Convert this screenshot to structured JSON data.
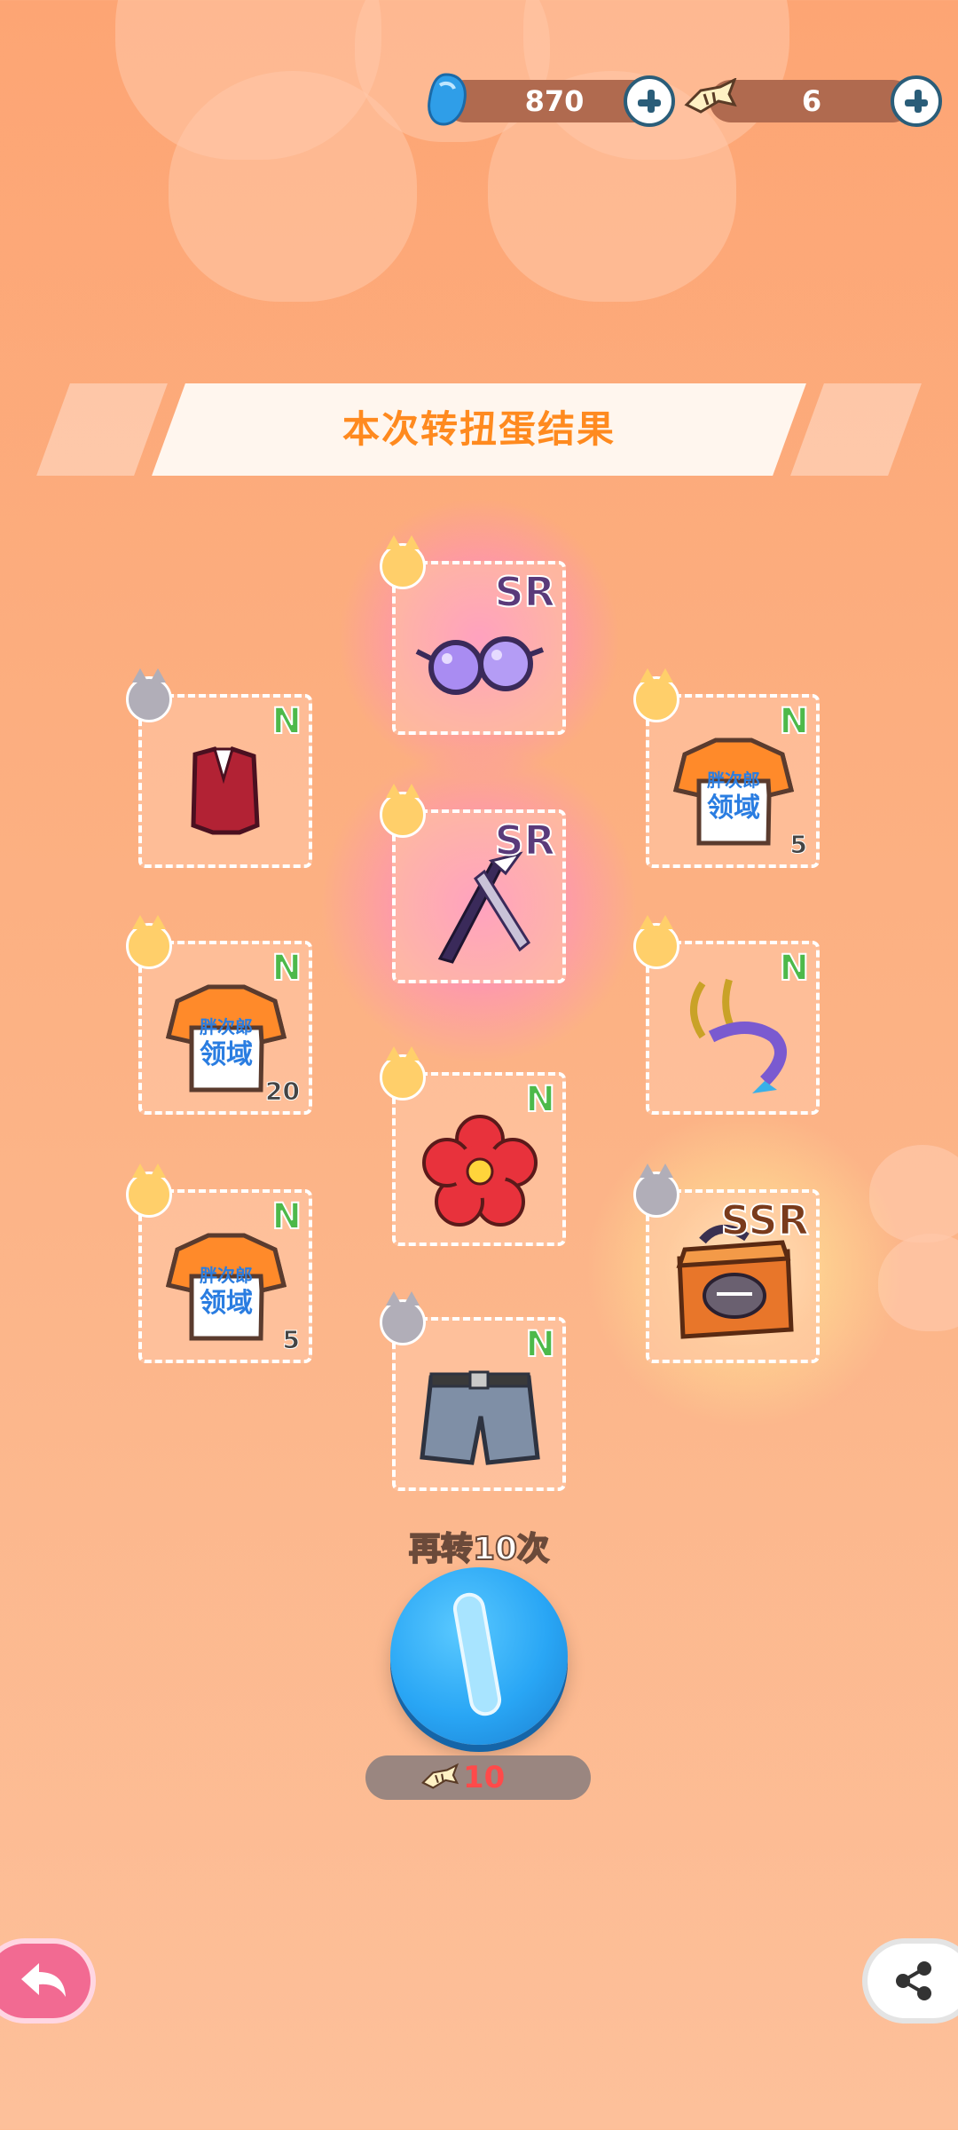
{
  "colors": {
    "background": "#fda574",
    "title_text": "#ff8a1f",
    "rarity_N": "#4db94a",
    "rarity_SR": "#5a3a7a",
    "rarity_SSR": "#7a3b1c",
    "spin_button": "#29a6f5",
    "cost_text": "#ff4a4a"
  },
  "header": {
    "gem": {
      "icon": "blue-gem-icon",
      "value": "870"
    },
    "ticket": {
      "icon": "fish-ticket-icon",
      "value": "6"
    }
  },
  "banner": {
    "title": "本次转扭蛋结果"
  },
  "results": [
    {
      "item": "purple-glasses",
      "rarity": "SR",
      "owner": "orange-cat-avatar",
      "count": ""
    },
    {
      "item": "red-vest",
      "rarity": "N",
      "owner": "grey-cat-avatar",
      "count": ""
    },
    {
      "item": "orange-tshirt",
      "rarity": "N",
      "owner": "orange-cat-avatar",
      "count": "5"
    },
    {
      "item": "purple-scissors",
      "rarity": "SR",
      "owner": "orange-cat-avatar",
      "count": ""
    },
    {
      "item": "orange-tshirt",
      "rarity": "N",
      "owner": "orange-cat-avatar",
      "count": "20"
    },
    {
      "item": "horn-tail-accessory",
      "rarity": "N",
      "owner": "orange-cat-avatar",
      "count": ""
    },
    {
      "item": "red-flower",
      "rarity": "N",
      "owner": "orange-cat-avatar",
      "count": ""
    },
    {
      "item": "orange-tshirt",
      "rarity": "N",
      "owner": "orange-cat-avatar",
      "count": "5"
    },
    {
      "item": "orange-crate",
      "rarity": "SSR",
      "owner": "grey-cat-avatar",
      "count": ""
    },
    {
      "item": "denim-shorts",
      "rarity": "N",
      "owner": "grey-cat-avatar",
      "count": ""
    }
  ],
  "tshirt_print": {
    "line1": "胖次郎",
    "line2": "领域"
  },
  "spin": {
    "label": "再转10次",
    "cost_icon": "fish-ticket-icon",
    "cost": "10"
  },
  "footer": {
    "back_icon": "back-arrow-icon",
    "share_icon": "share-icon"
  }
}
